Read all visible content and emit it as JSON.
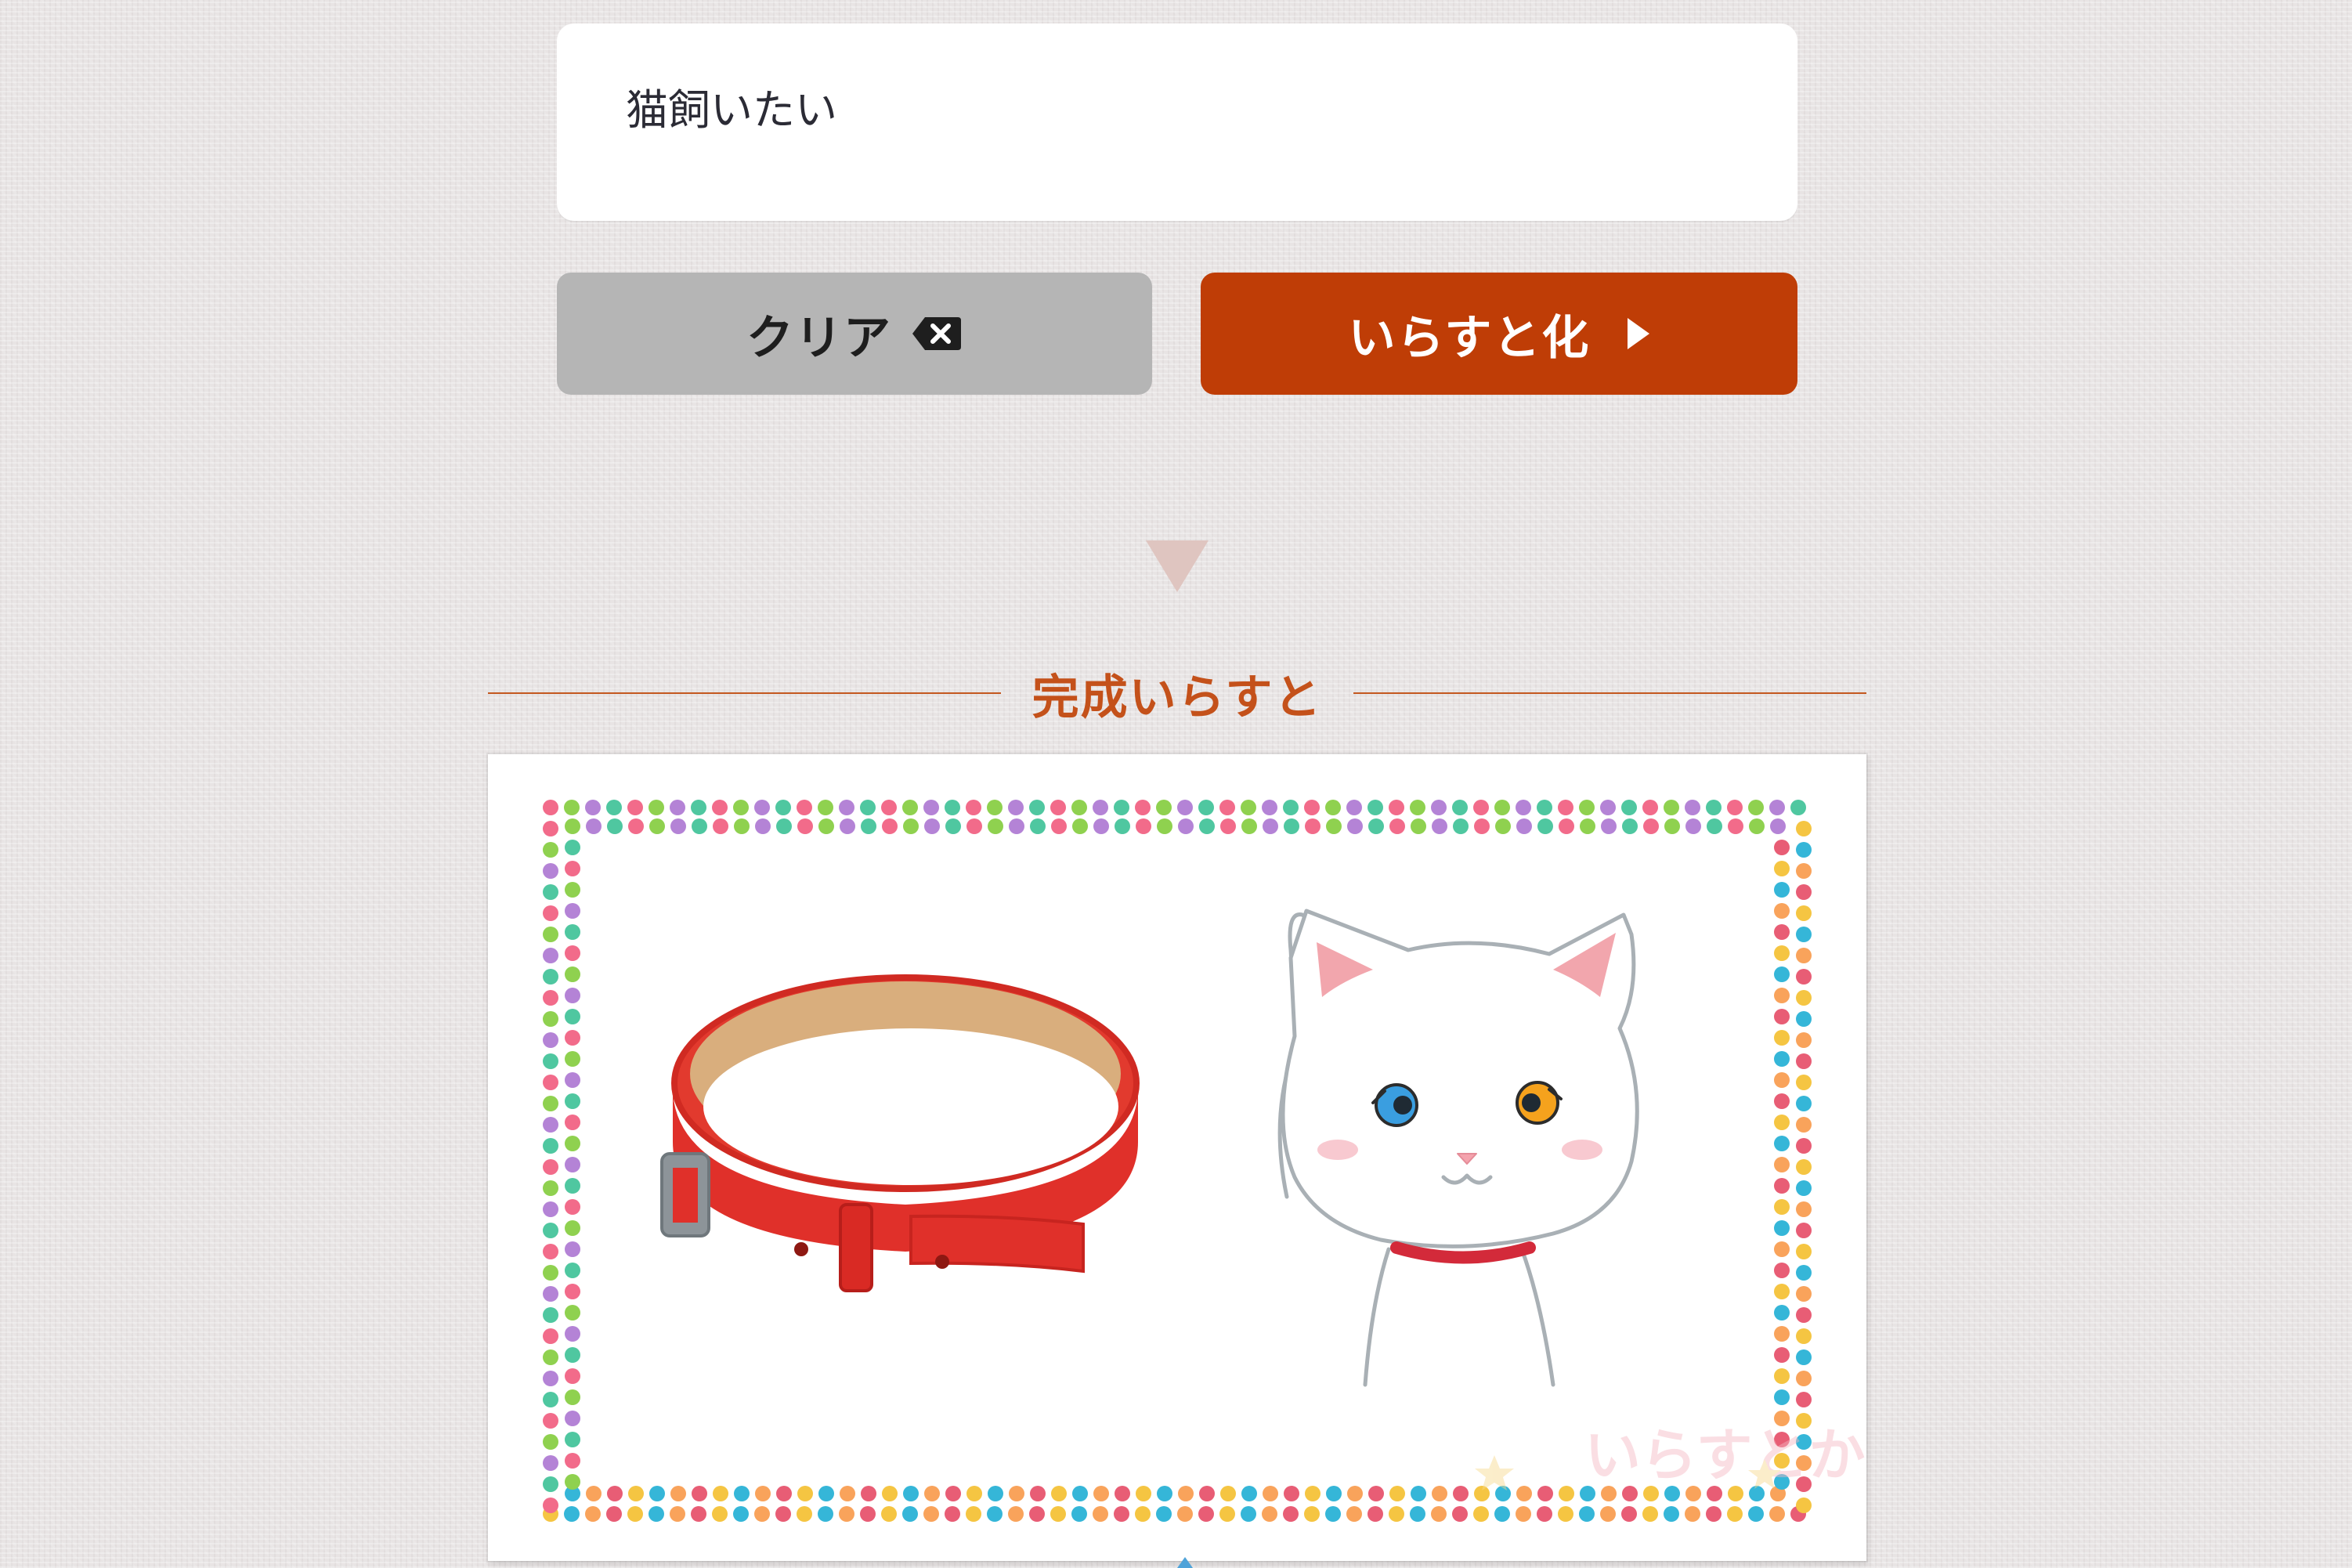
{
  "input": {
    "value": "猫飼いたい"
  },
  "buttons": {
    "clear_label": "クリア",
    "convert_label": "いらすと化"
  },
  "result": {
    "heading": "完成いらすと",
    "watermark": "いらすとか"
  },
  "colors": {
    "accent": "#bf3d06",
    "clear_button": "#b5b5b5",
    "heading_text": "#c4511a"
  },
  "icons": {
    "clear": "backspace-icon",
    "convert": "play-triangle-icon",
    "flow": "down-triangle-icon"
  }
}
